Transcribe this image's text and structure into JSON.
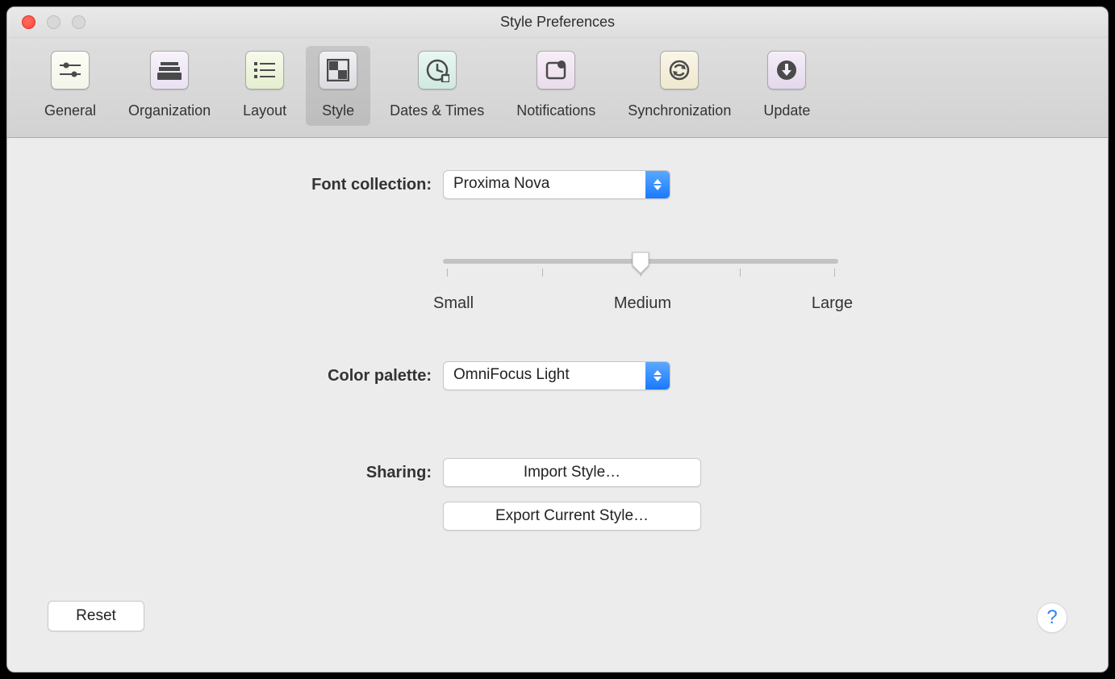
{
  "window": {
    "title": "Style Preferences"
  },
  "toolbar": {
    "items": [
      {
        "label": "General",
        "selected": false
      },
      {
        "label": "Organization",
        "selected": false
      },
      {
        "label": "Layout",
        "selected": false
      },
      {
        "label": "Style",
        "selected": true
      },
      {
        "label": "Dates & Times",
        "selected": false
      },
      {
        "label": "Notifications",
        "selected": false
      },
      {
        "label": "Synchronization",
        "selected": false
      },
      {
        "label": "Update",
        "selected": false
      }
    ]
  },
  "font": {
    "label": "Font collection:",
    "value": "Proxima Nova",
    "slider": {
      "labels": [
        "Small",
        "Medium",
        "Large"
      ],
      "value": 1
    }
  },
  "palette": {
    "label": "Color palette:",
    "value": "OmniFocus Light"
  },
  "sharing": {
    "label": "Sharing:",
    "import": "Import Style…",
    "export": "Export Current Style…"
  },
  "footer": {
    "reset": "Reset",
    "help": "?"
  }
}
